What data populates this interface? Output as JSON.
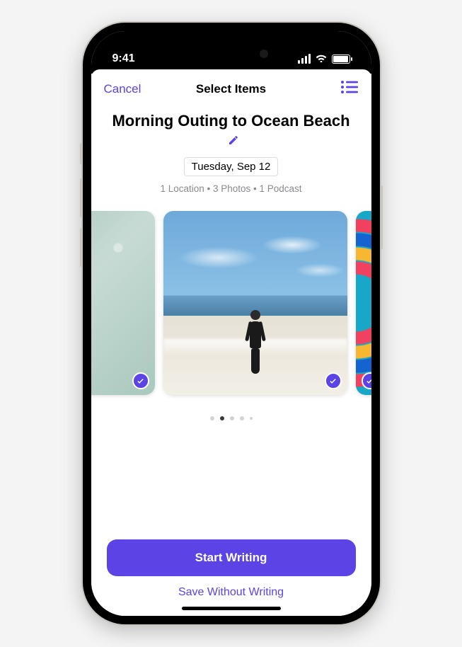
{
  "status": {
    "time": "9:41"
  },
  "nav": {
    "cancel": "Cancel",
    "title": "Select Items"
  },
  "entry": {
    "title": "Morning Outing to Ocean Beach",
    "date": "Tuesday, Sep 12",
    "summary": "1 Location • 3 Photos • 1 Podcast"
  },
  "carousel": {
    "items": [
      {
        "kind": "photo-texture",
        "selected": true
      },
      {
        "kind": "photo-beach",
        "selected": true
      },
      {
        "kind": "podcast-artwork",
        "selected": true
      }
    ],
    "page_count": 5,
    "active_page_index": 1
  },
  "actions": {
    "primary": "Start Writing",
    "secondary": "Save Without Writing"
  },
  "colors": {
    "accent": "#5b43e5"
  }
}
